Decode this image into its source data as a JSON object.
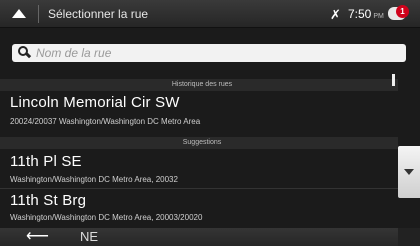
{
  "topbar": {
    "title": "Sélectionner la rue",
    "sat_icon": "satellite-icon",
    "time": "7:50",
    "time_suffix": "PM",
    "message_count": "1"
  },
  "search": {
    "value": "",
    "placeholder": "Nom de la rue"
  },
  "sections": {
    "history": "Historique des rues",
    "suggestions": "Suggestions"
  },
  "history_items": [
    {
      "title": "Lincoln Memorial Cir SW",
      "subtitle": "20024/20037 Washington/Washington DC Metro Area"
    }
  ],
  "suggestion_items": [
    {
      "title": "11th Pl SE",
      "subtitle": "Washington/Washington DC Metro Area, 20032"
    },
    {
      "title": "11th St Brg",
      "subtitle": "Washington/Washington DC Metro Area, 20003/20020"
    },
    {
      "title": "NE",
      "subtitle": ""
    }
  ],
  "icons": {
    "up": "up-arrow-icon",
    "back": "back-arrow-icon",
    "scroll_down": "scroll-down-icon"
  }
}
